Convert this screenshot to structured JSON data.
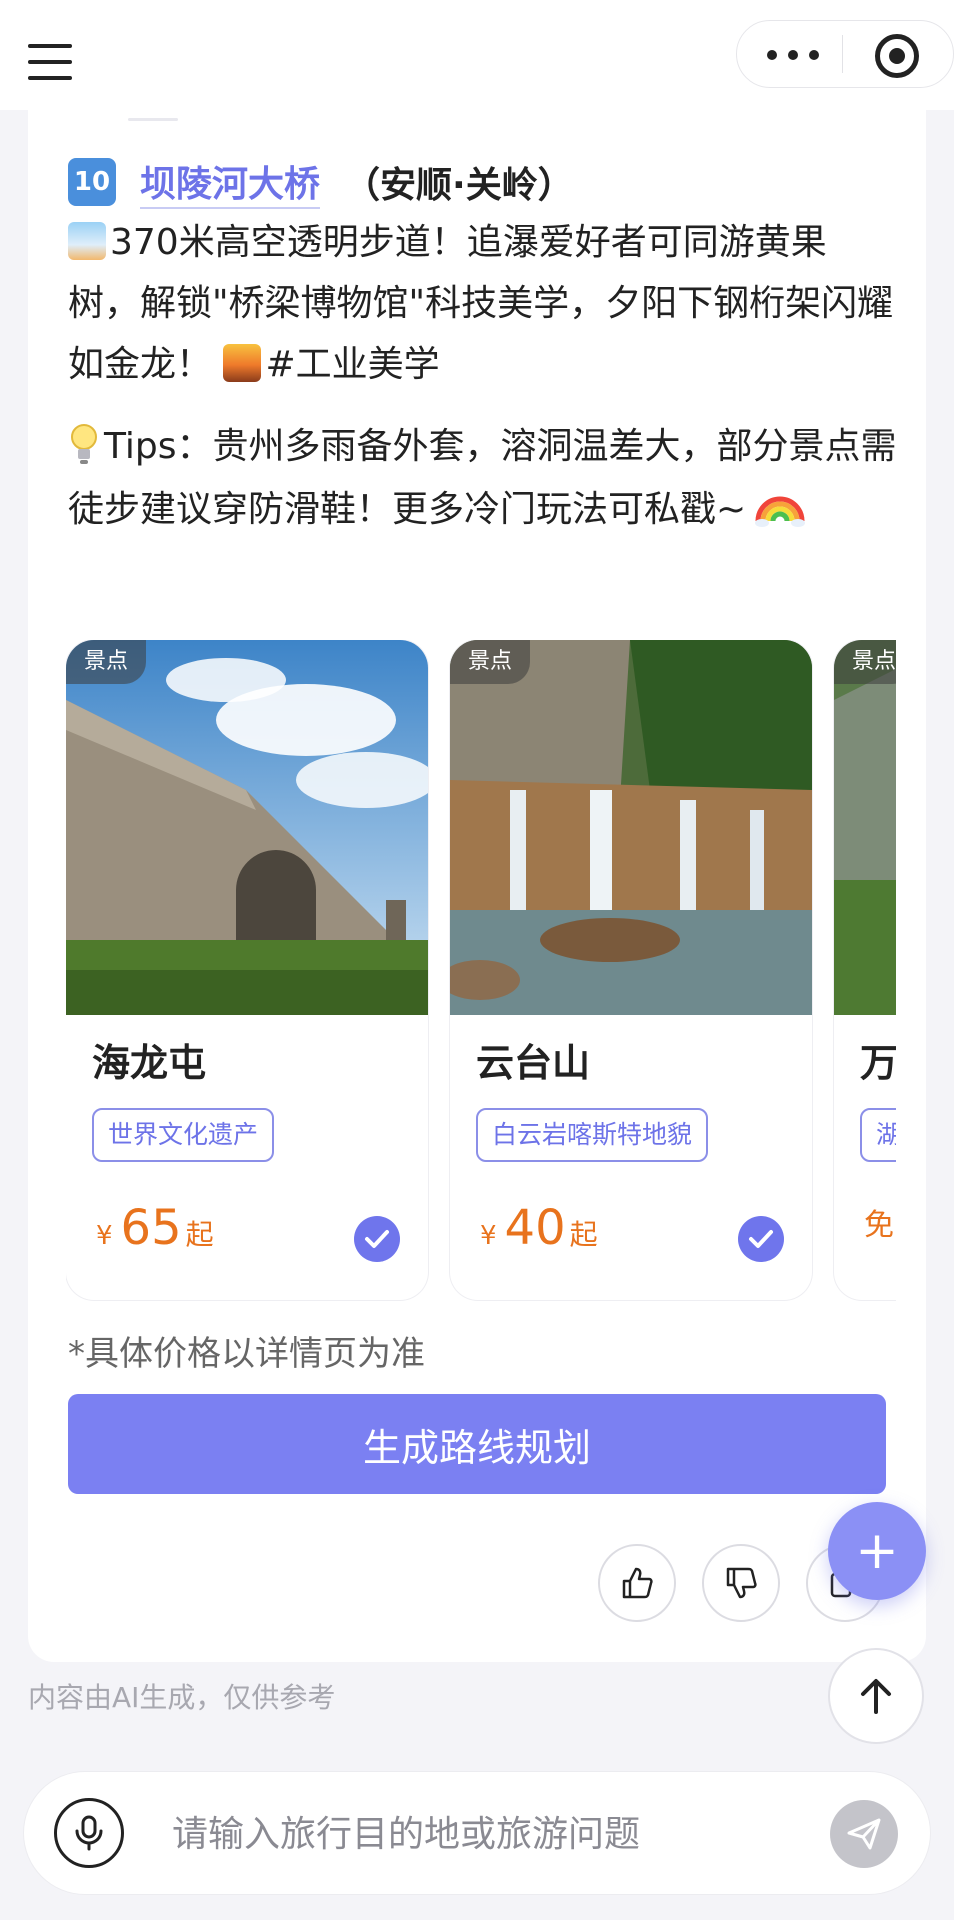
{
  "header": {
    "menu_icon": "hamburger-icon",
    "more_icon": "more-dots-icon",
    "close_icon": "target-circle-icon"
  },
  "item": {
    "number": "10",
    "name": "坝陵河大桥",
    "location": "（安顺·关岭）",
    "desc_part1": "370米高空透明步道！追瀑爱好者可同游黄果树，解锁\"桥梁博物馆\"科技美学，夕阳下钢桁架闪耀如金龙！",
    "hashtag": "#工业美学"
  },
  "tips": {
    "text": "Tips：贵州多雨备外套，溶洞温差大，部分景点需徒步建议穿防滑鞋！更多冷门玩法可私戳~"
  },
  "cards": [
    {
      "tag": "景点",
      "name": "海龙屯",
      "highlight": "世界文化遗产",
      "currency": "¥",
      "price": "65",
      "suffix": "起",
      "selected": true
    },
    {
      "tag": "景点",
      "name": "云台山",
      "highlight": "白云岩喀斯特地貌",
      "currency": "¥",
      "price": "40",
      "suffix": "起",
      "selected": true
    },
    {
      "tag": "景点",
      "name": "万",
      "highlight": "湖",
      "price_text": "免"
    }
  ],
  "price_note": "*具体价格以详情页为准",
  "generate_button": "生成路线规划",
  "feedback": {
    "like_icon": "thumbs-up-icon",
    "dislike_icon": "thumbs-down-icon",
    "copy_icon": "copy-icon"
  },
  "fab": {
    "plus": "+"
  },
  "ai_disclaimer": "内容由AI生成，仅供参考",
  "input": {
    "placeholder": "请输入旅行目的地或旅游问题",
    "value": ""
  },
  "colors": {
    "accent": "#7b80f2",
    "price": "#e8731d",
    "link": "#6d73e8"
  }
}
